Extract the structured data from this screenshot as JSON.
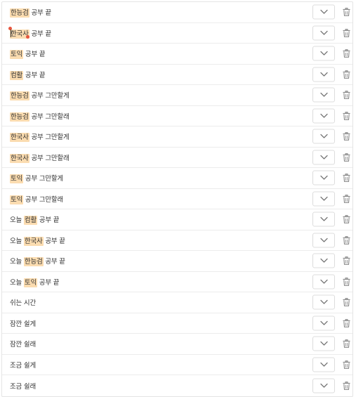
{
  "rows": [
    {
      "parts": [
        {
          "text": "한능검",
          "hl": true
        },
        {
          "text": " 공부 끝",
          "hl": false
        }
      ]
    },
    {
      "parts": [
        {
          "text": "한국사",
          "hl": true
        },
        {
          "text": " 공부 끝",
          "hl": false
        }
      ],
      "editing": true
    },
    {
      "parts": [
        {
          "text": "토익",
          "hl": true
        },
        {
          "text": " 공부 끝",
          "hl": false
        }
      ]
    },
    {
      "parts": [
        {
          "text": "컴활",
          "hl": true
        },
        {
          "text": " 공부 끝",
          "hl": false
        }
      ]
    },
    {
      "parts": [
        {
          "text": "한능검",
          "hl": true
        },
        {
          "text": " 공부 그만할게",
          "hl": false
        }
      ]
    },
    {
      "parts": [
        {
          "text": "한능검",
          "hl": true
        },
        {
          "text": " 공부 그만할래",
          "hl": false
        }
      ]
    },
    {
      "parts": [
        {
          "text": "한국사",
          "hl": true
        },
        {
          "text": " 공부 그만할게",
          "hl": false
        }
      ]
    },
    {
      "parts": [
        {
          "text": "한국사",
          "hl": true
        },
        {
          "text": " 공부 그만할래",
          "hl": false
        }
      ]
    },
    {
      "parts": [
        {
          "text": "토익",
          "hl": true
        },
        {
          "text": " 공부 그만할게",
          "hl": false
        }
      ]
    },
    {
      "parts": [
        {
          "text": "토익",
          "hl": true
        },
        {
          "text": " 공부 그만할래",
          "hl": false
        }
      ]
    },
    {
      "parts": [
        {
          "text": "오늘 ",
          "hl": false
        },
        {
          "text": "컴활",
          "hl": true
        },
        {
          "text": " 공부 끝",
          "hl": false
        }
      ]
    },
    {
      "parts": [
        {
          "text": "오늘 ",
          "hl": false
        },
        {
          "text": "한국사",
          "hl": true
        },
        {
          "text": " 공부 끝",
          "hl": false
        }
      ]
    },
    {
      "parts": [
        {
          "text": "오늘 ",
          "hl": false
        },
        {
          "text": "한능검",
          "hl": true
        },
        {
          "text": " 공부 끝",
          "hl": false
        }
      ]
    },
    {
      "parts": [
        {
          "text": "오늘 ",
          "hl": false
        },
        {
          "text": "토익",
          "hl": true
        },
        {
          "text": " 공부 끝",
          "hl": false
        }
      ]
    },
    {
      "parts": [
        {
          "text": "쉬는 시간",
          "hl": false
        }
      ]
    },
    {
      "parts": [
        {
          "text": "잠깐 쉴게",
          "hl": false
        }
      ]
    },
    {
      "parts": [
        {
          "text": "잠깐 쉴래",
          "hl": false
        }
      ]
    },
    {
      "parts": [
        {
          "text": "조금 쉴게",
          "hl": false
        }
      ]
    },
    {
      "parts": [
        {
          "text": "조금 쉴래",
          "hl": false
        }
      ]
    }
  ],
  "icons": {
    "dropdown": "chevron-down-icon",
    "delete": "trash-icon"
  },
  "colors": {
    "highlight": "#fbdcb0",
    "marker": "#e8553e",
    "border": "#e4e4e4",
    "icon": "#8a8a8a"
  }
}
